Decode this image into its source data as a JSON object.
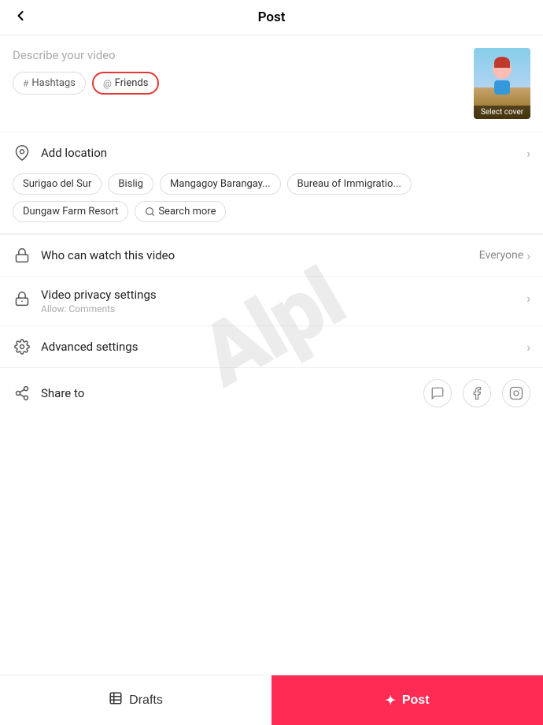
{
  "header": {
    "title": "Post",
    "back_icon": "‹"
  },
  "description": {
    "placeholder": "Describe your video"
  },
  "tags": [
    {
      "id": "hashtags",
      "icon": "#",
      "label": "Hashtags",
      "highlighted": false
    },
    {
      "id": "friends",
      "icon": "@",
      "label": "Friends",
      "highlighted": true
    }
  ],
  "cover": {
    "label": "Select cover"
  },
  "location": {
    "label": "Add location",
    "tags": [
      "Surigao del Sur",
      "Bislig",
      "Mangagoy Barangay...",
      "Bureau of Immigratio...",
      "Dungaw Farm Resort"
    ],
    "search_label": "Search more"
  },
  "who_can_watch": {
    "label": "Who can watch this video",
    "value": "Everyone"
  },
  "video_privacy": {
    "label": "Video privacy settings",
    "sub_label": "Allow: Comments"
  },
  "advanced_settings": {
    "label": "Advanced settings"
  },
  "share_to": {
    "label": "Share to"
  },
  "watermark": {
    "text": "AlpI"
  },
  "bottom": {
    "drafts_label": "Drafts",
    "post_label": "Post"
  }
}
